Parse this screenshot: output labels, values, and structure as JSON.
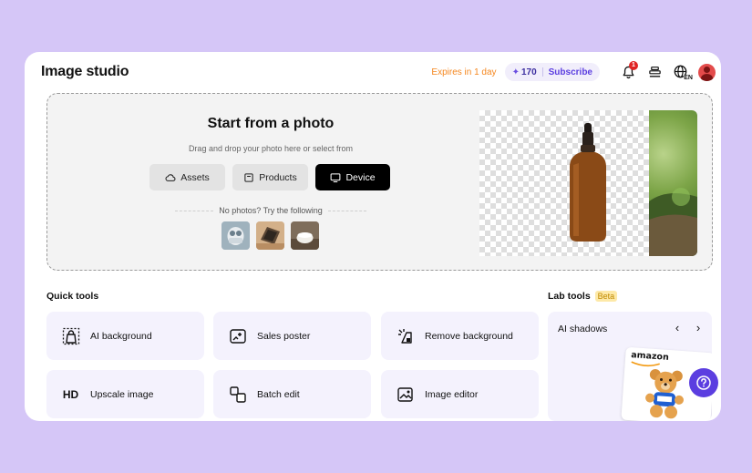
{
  "app": {
    "title": "Image studio"
  },
  "topbar": {
    "expires_text": "Expires in 1 day",
    "credits_count": "170",
    "subscribe_label": "Subscribe",
    "notification_count": "1",
    "language": "EN"
  },
  "upload": {
    "title": "Start from a photo",
    "subtitle": "Drag and drop your photo here or select from",
    "sources": [
      {
        "label": "Assets",
        "icon": "cloud-icon"
      },
      {
        "label": "Products",
        "icon": "product-box-icon"
      },
      {
        "label": "Device",
        "icon": "monitor-icon"
      }
    ],
    "try_text": "No photos? Try the following"
  },
  "quick_tools": {
    "title": "Quick tools",
    "items": [
      {
        "label": "AI background",
        "icon": "ai-background-icon"
      },
      {
        "label": "Sales poster",
        "icon": "sales-poster-icon"
      },
      {
        "label": "Remove background",
        "icon": "remove-background-icon"
      },
      {
        "label": "Upscale image",
        "icon": "hd-icon",
        "icon_text": "HD"
      },
      {
        "label": "Batch edit",
        "icon": "batch-edit-icon"
      },
      {
        "label": "Image editor",
        "icon": "image-editor-icon"
      }
    ]
  },
  "lab_tools": {
    "title": "Lab tools",
    "badge": "Beta",
    "current": "AI shadows",
    "preview_brand": "amazon"
  },
  "colors": {
    "accent": "#5b3ee0",
    "expires": "#f5871f",
    "background": "#d5c6f7",
    "card": "#f4f2fd"
  }
}
